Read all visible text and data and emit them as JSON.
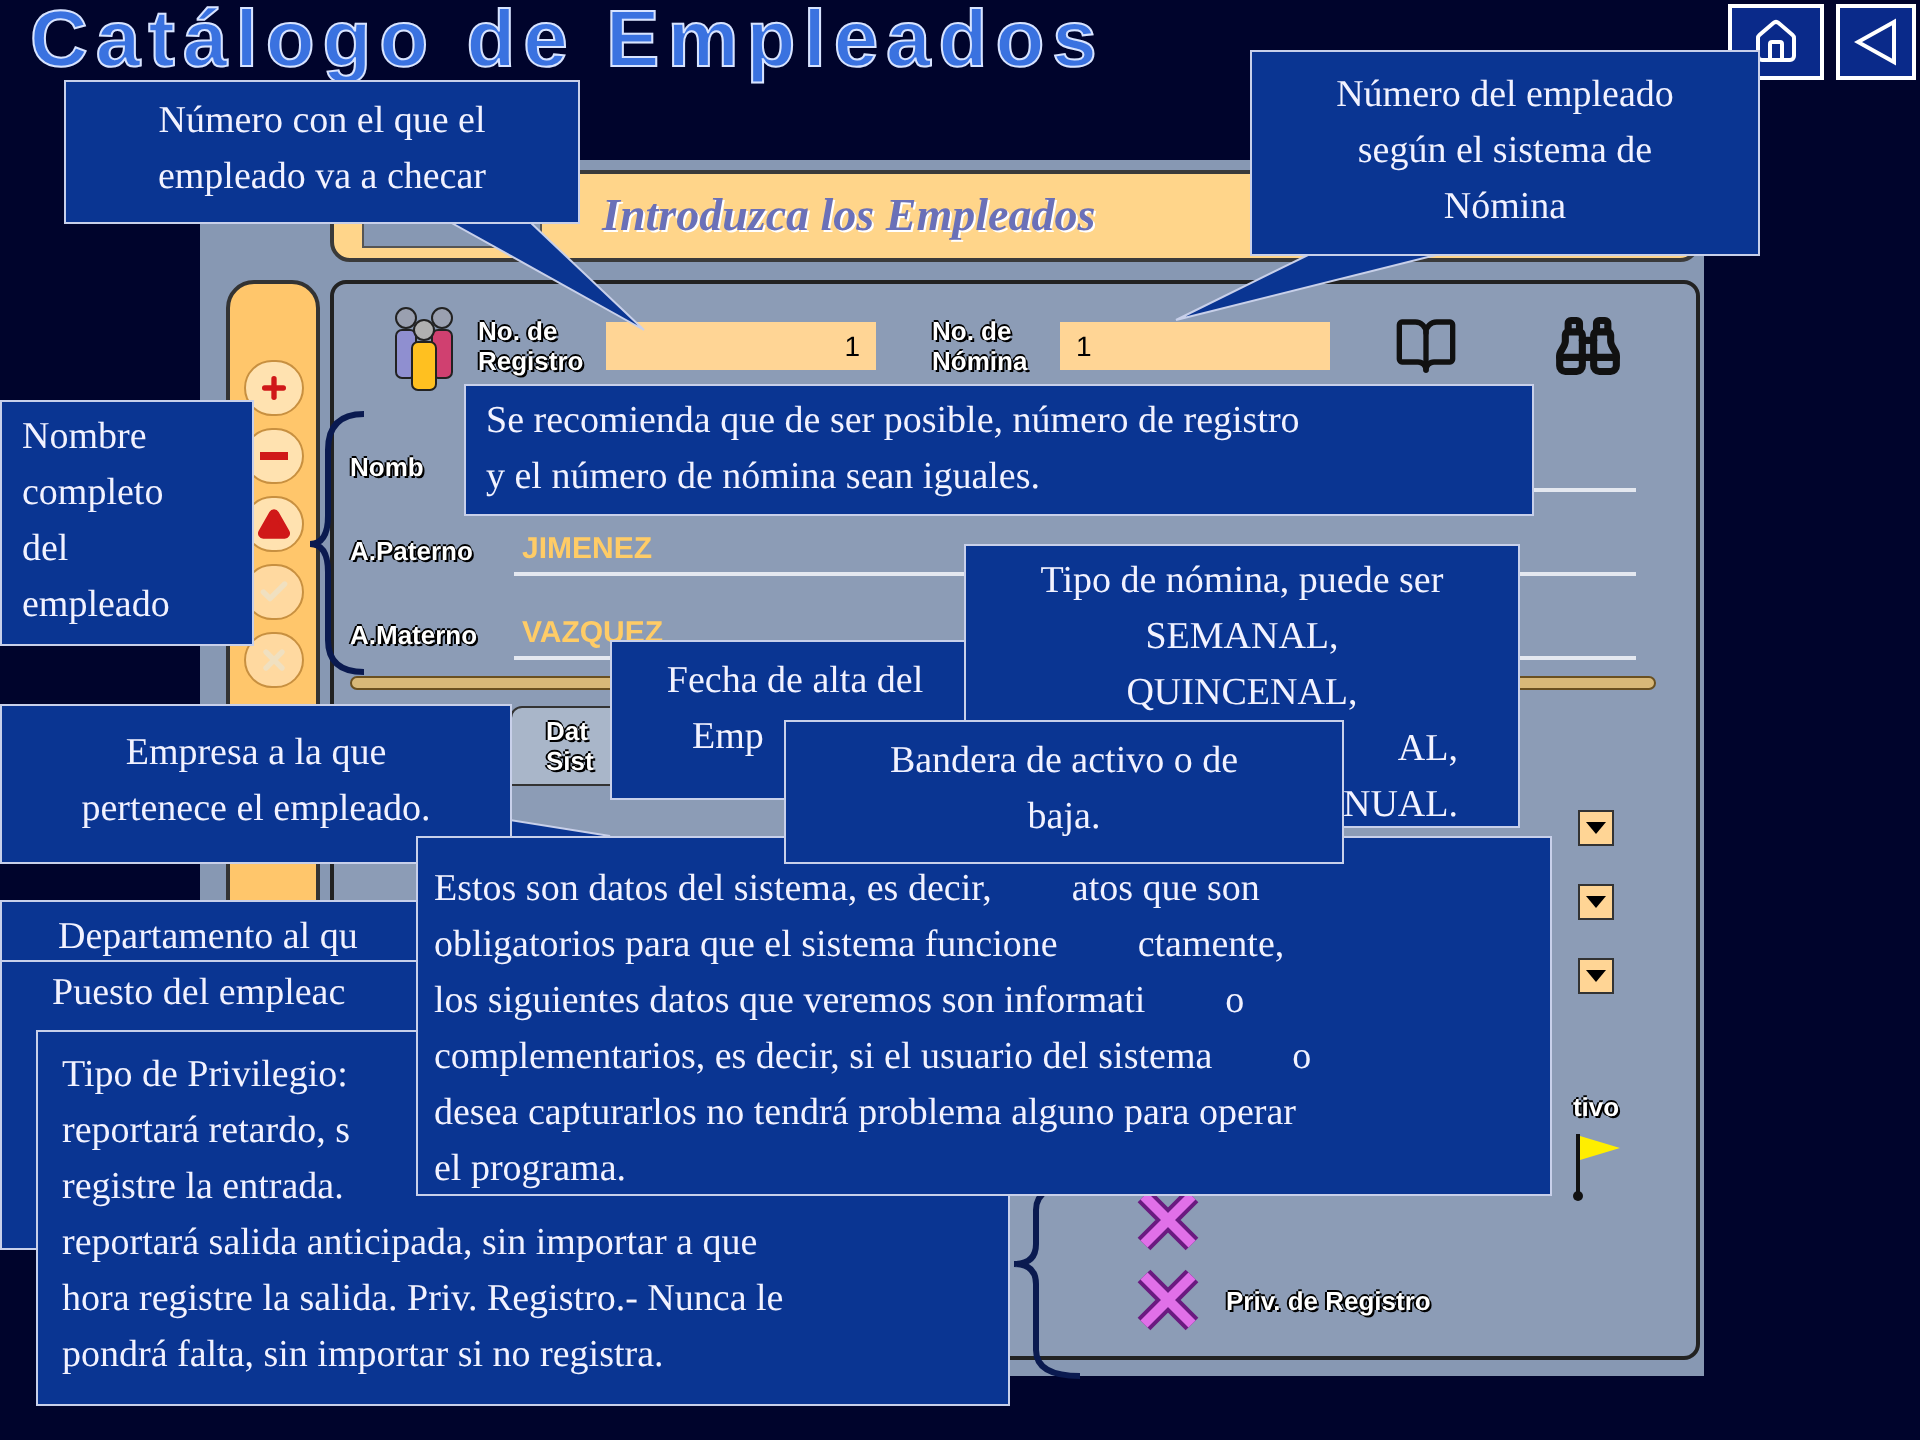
{
  "slide_title": "Catálogo de Empleados",
  "app": {
    "header": "Introduzca los Empleados",
    "toolbar": [
      {
        "disabled": false
      },
      {
        "disabled": false
      },
      {
        "disabled": false
      },
      {
        "disabled": true
      },
      {
        "disabled": true
      }
    ],
    "registro": {
      "label": [
        "No. de",
        "Registro"
      ],
      "value": "1"
    },
    "nomina": {
      "label": [
        "No. de",
        "Nómina"
      ],
      "value": "1"
    },
    "name_fields": [
      {
        "label": "Nomb"
      },
      {
        "label": "A.Paterno",
        "value": "JIMENEZ"
      },
      {
        "label": "A.Materno",
        "value": "VAZQUEZ"
      }
    ],
    "tab": {
      "lines": [
        "Dat",
        "Sist"
      ]
    },
    "status_label": "tivo",
    "privileges": [
      {
        "checked": false
      },
      {
        "checked": false,
        "label": "Priv. de Registro"
      }
    ]
  },
  "callouts": [
    {
      "lines": [
        "Número con el que el",
        "empleado va a checar"
      ]
    },
    {
      "lines": [
        "Número del empleado",
        "según el sistema de",
        "Nómina"
      ]
    },
    {
      "lines": [
        "Nombre",
        "completo",
        "del",
        "empleado"
      ]
    },
    {
      "lines": [
        "Se recomienda que de ser posible, número de registro",
        "y el número de nómina sean iguales."
      ]
    },
    {
      "lines": [
        "Empresa a la que",
        "pertenece el empleado."
      ]
    },
    {
      "lines": [
        "Fecha de alta del",
        "Emp"
      ]
    },
    {
      "lines": [
        "Tipo de nómina, puede ser",
        "SEMANAL,",
        "QUINCENAL,",
        "AL,",
        "NUAL."
      ]
    },
    {
      "lines": [
        "Bandera de activo o de",
        "baja."
      ]
    },
    {
      "lines": [
        "Departamento al qu"
      ]
    },
    {
      "lines": [
        "Puesto del empleac"
      ]
    },
    {
      "lines": [
        "Tipo de Privilegio:",
        "reportará retardo, s",
        "registre la entrada.",
        "reportará salida anticipada, sin importar a que",
        "hora registre la salida. Priv. Registro.- Nunca le",
        "pondrá falta, sin importar si no registra."
      ]
    },
    {
      "lines": [
        [
          "Estos son datos del sistema, es decir,",
          "atos que son"
        ],
        [
          "obligatorios para que el sistema funcione",
          "ctamente,"
        ],
        [
          "los siguientes datos que veremos son informati",
          "o"
        ],
        [
          "complementarios, es decir, si el usuario del sistema",
          "o"
        ],
        [
          "desea capturarlos no tendrá problema alguno para operar"
        ],
        [
          "el programa."
        ]
      ]
    }
  ]
}
